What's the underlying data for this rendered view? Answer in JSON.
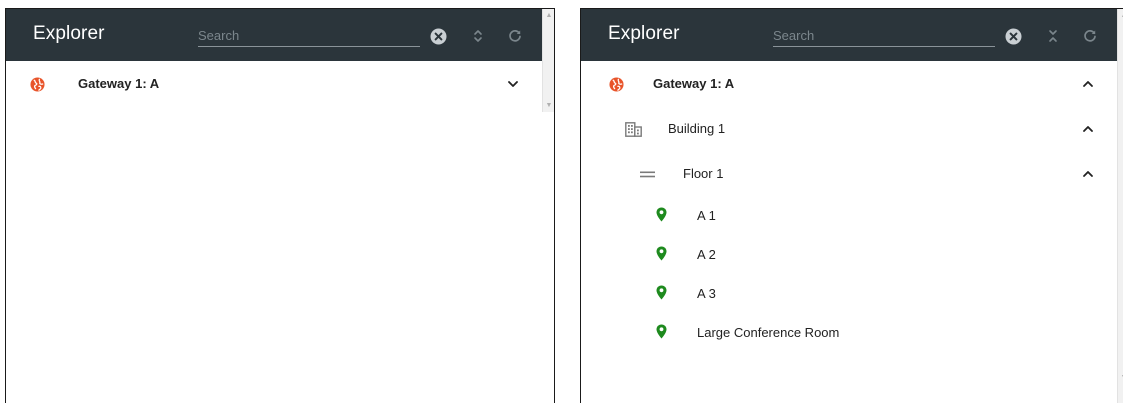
{
  "colors": {
    "header_bg": "#2b353b",
    "gateway_icon": "#e8542a",
    "location_pin": "#1e8a1e",
    "icon_gray": "#7a7a7a"
  },
  "left_panel": {
    "title": "Explorer",
    "search_placeholder": "Search",
    "tree": {
      "gateway": {
        "label": "Gateway 1: A",
        "expanded": false
      }
    }
  },
  "right_panel": {
    "title": "Explorer",
    "search_placeholder": "Search",
    "tree": {
      "gateway": {
        "label": "Gateway 1: A",
        "expanded": true
      },
      "building": {
        "label": "Building 1",
        "expanded": true
      },
      "floor": {
        "label": "Floor 1",
        "expanded": true
      },
      "rooms": [
        {
          "label": "A 1"
        },
        {
          "label": "A 2"
        },
        {
          "label": "A 3"
        },
        {
          "label": "Large Conference Room"
        }
      ]
    }
  },
  "icons": {
    "clear": "clear-circle-icon",
    "collapse_left": "expand-all-icon",
    "collapse_right": "collapse-all-icon",
    "refresh": "refresh-icon",
    "gateway": "globe-icon",
    "building": "building-icon",
    "floor": "floor-icon",
    "room": "location-pin-icon"
  }
}
